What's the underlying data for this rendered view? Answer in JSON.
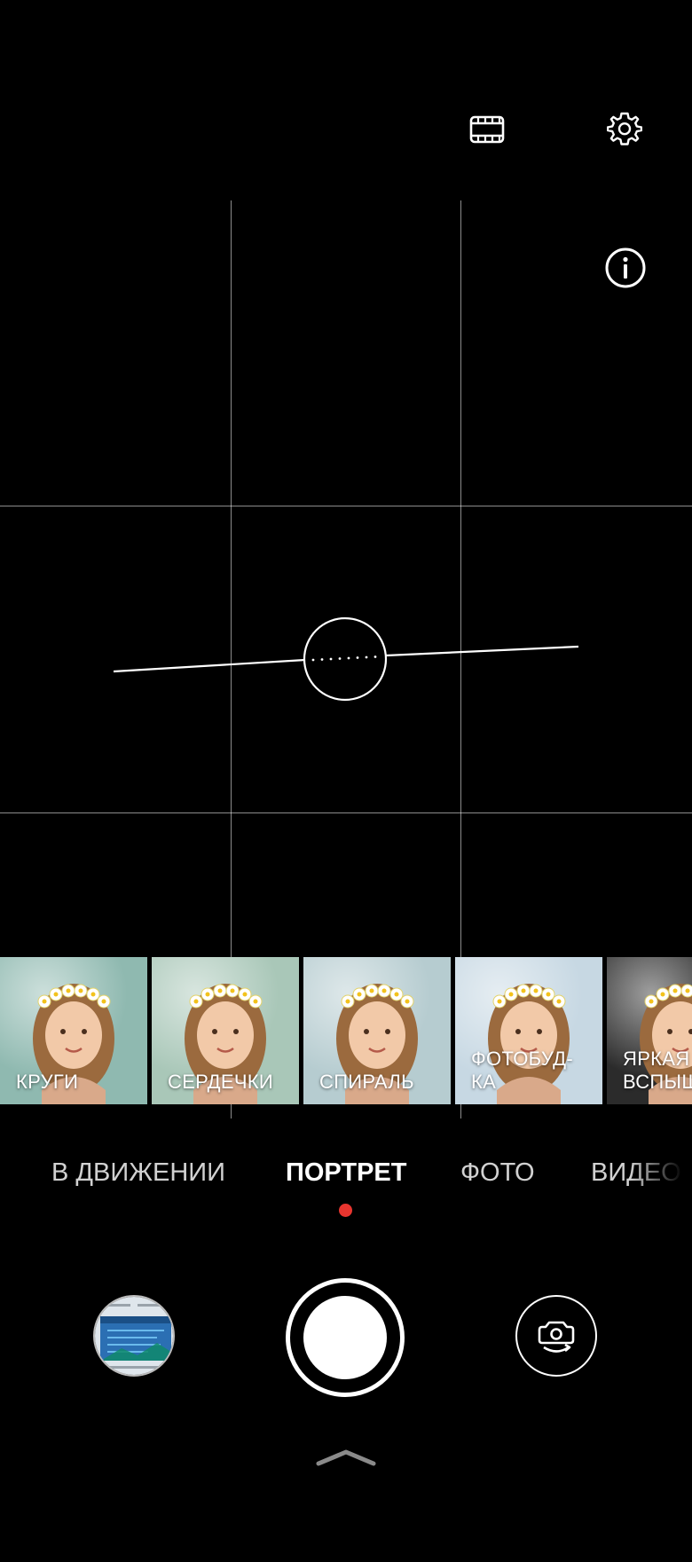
{
  "top_bar": {
    "film_icon": "film-strip-icon",
    "settings_icon": "gear-icon",
    "info_icon": "info-icon"
  },
  "filters": [
    {
      "label": "КРУГИ",
      "selected": true,
      "bg": "#8fb9b0"
    },
    {
      "label": "СЕРДЕЧКИ",
      "selected": false,
      "bg": "#a9c7b8"
    },
    {
      "label": "СПИРАЛЬ",
      "selected": false,
      "bg": "#b6ccd0"
    },
    {
      "label": "ФОТОБУД-\nКА",
      "selected": false,
      "bg": "#c7d8e3"
    },
    {
      "label": "ЯРКАЯ\nВСПЫШ",
      "selected": false,
      "bg": "#2b2b2b"
    }
  ],
  "modes": {
    "items": [
      {
        "label": "В ДВИЖЕНИИ",
        "active": false
      },
      {
        "label": "ПОРТРЕТ",
        "active": true
      },
      {
        "label": "ФОТО",
        "active": false
      },
      {
        "label": "ВИДЕО",
        "active": false
      }
    ],
    "indicator_color": "#e8352f"
  },
  "controls": {
    "gallery_icon": "gallery-thumbnail",
    "shutter_icon": "shutter-button",
    "switch_icon": "switch-camera-icon",
    "expand_icon": "chevron-up-icon"
  }
}
